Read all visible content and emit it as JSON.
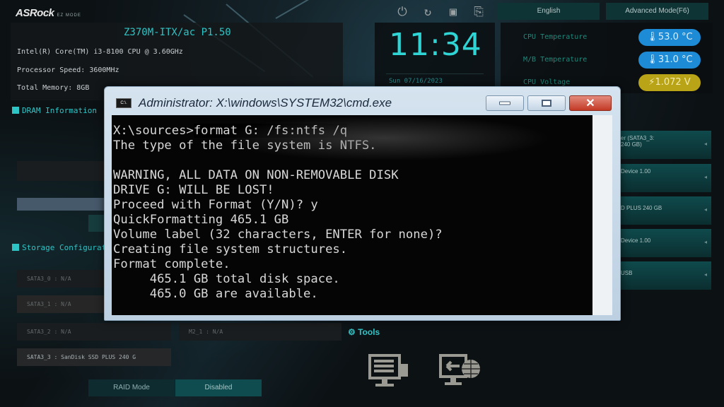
{
  "header": {
    "brand": "ASRock",
    "mode": "EZ MODE",
    "model": "Z370M-ITX/ac P1.50",
    "cpu": "Intel(R) Core(TM) i3-8100 CPU @ 3.60GHz",
    "processor_speed": "Processor Speed: 3600MHz",
    "total_memory": "Total Memory: 8GB",
    "language_button": "English",
    "advanced_mode_button": "Advanced Mode(F6)",
    "icons": [
      "power-icon",
      "reset-icon",
      "save-icon",
      "exit-icon"
    ]
  },
  "clock": {
    "time": "11:34",
    "date": "Sun 07/16/2023"
  },
  "sensors": [
    {
      "label": "CPU Temperature",
      "value": "53.0 °C",
      "icon": "thermometer-icon",
      "color": "#1e8bd6"
    },
    {
      "label": "M/B Temperature",
      "value": "31.0 °C",
      "icon": "thermometer-icon",
      "color": "#1e8bd6"
    },
    {
      "label": "CPU Voltage",
      "value": "1.072 V",
      "icon": "lightning-icon",
      "color": "#b9a316"
    }
  ],
  "dram": {
    "title": "DRAM Information"
  },
  "storage": {
    "title": "Storage Configuration",
    "ports": [
      {
        "label": "SATA3_0 : N/A"
      },
      {
        "label": "SATA3_1 : N/A"
      },
      {
        "label": "SATA3_2 : N/A"
      },
      {
        "label": "SATA3_3 : SanDisk SSD PLUS 240 G"
      }
    ],
    "m2": {
      "label": "M2_1 : N/A"
    },
    "raid_label": "RAID Mode",
    "raid_value": "Disabled"
  },
  "tools": {
    "title": "Tools",
    "items": [
      "flash-bios-icon",
      "internet-flash-icon"
    ]
  },
  "boot_priority": [
    {
      "label": "er (SATA3_3:",
      "sub": "240 GB)"
    },
    {
      "label": "Device 1.00",
      "sub": ""
    },
    {
      "label": "D PLUS 240 GB",
      "sub": ""
    },
    {
      "label": "Device 1.00",
      "sub": ""
    },
    {
      "label": "USB",
      "sub": ""
    }
  ],
  "cmd": {
    "title": "Administrator: X:\\windows\\SYSTEM32\\cmd.exe",
    "icon_label": "C:\\.",
    "prompt": "X:\\sources>",
    "command": "format G: /fs:ntfs /q",
    "output": [
      "The type of the file system is NTFS.",
      "",
      "WARNING, ALL DATA ON NON-REMOVABLE DISK",
      "DRIVE G: WILL BE LOST!",
      "Proceed with Format (Y/N)? y",
      "QuickFormatting 465.1 GB",
      "Volume label (32 characters, ENTER for none)?",
      "Creating file system structures.",
      "Format complete.",
      "     465.1 GB total disk space.",
      "     465.0 GB are available."
    ],
    "close_glyph": "✕"
  }
}
